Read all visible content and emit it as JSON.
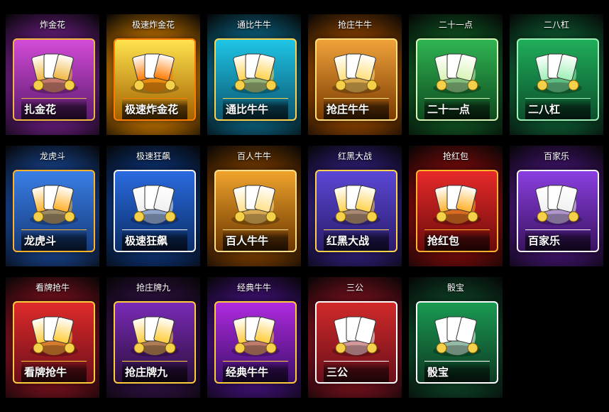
{
  "games": [
    {
      "title": "炸金花",
      "label": "扎金花",
      "icon": "cards-and-chips-icon",
      "colors": [
        "#5b1a6e",
        "#d34bd8",
        "#f0b640"
      ]
    },
    {
      "title": "极速炸金花",
      "label": "极速炸金花",
      "icon": "bomb-and-cards-icon",
      "colors": [
        "#a36100",
        "#ffe34d",
        "#ff7a00"
      ]
    },
    {
      "title": "通比牛牛",
      "label": "通比牛牛",
      "icon": "cow-with-gold-icon",
      "colors": [
        "#0a5670",
        "#1fc6e6",
        "#ffd24d"
      ]
    },
    {
      "title": "抢庄牛牛",
      "label": "抢庄牛牛",
      "icon": "ox-with-coins-icon",
      "colors": [
        "#7a3a00",
        "#f0a23a",
        "#ffe07a"
      ]
    },
    {
      "title": "二十一点",
      "label": "二十一点",
      "icon": "blackjack-cards-icon",
      "colors": [
        "#0e4a1e",
        "#2fb452",
        "#d8f4b6"
      ]
    },
    {
      "title": "二八杠",
      "label": "二八杠",
      "icon": "mahjong-tiles-icon",
      "colors": [
        "#0c4f2c",
        "#1fae5a",
        "#9ef0b6"
      ]
    },
    {
      "title": "龙虎斗",
      "label": "龙虎斗",
      "icon": "dragon-tiger-icon",
      "colors": [
        "#153a7a",
        "#3a7fe6",
        "#ffb12a"
      ]
    },
    {
      "title": "极速狂飙",
      "label": "极速狂飙",
      "icon": "race-car-icon",
      "colors": [
        "#0b2d66",
        "#2a6be0",
        "#f0f0f0"
      ]
    },
    {
      "title": "百人牛牛",
      "label": "百人牛牛",
      "icon": "pirate-cow-icon",
      "colors": [
        "#6a3500",
        "#f0a42c",
        "#ffe08a"
      ]
    },
    {
      "title": "红黑大战",
      "label": "红黑大战",
      "icon": "warriors-vs-icon",
      "colors": [
        "#2b1b6a",
        "#5a48d6",
        "#ffd24d"
      ]
    },
    {
      "title": "抢红包",
      "label": "抢红包",
      "icon": "red-envelope-girl-icon",
      "colors": [
        "#6a0a0a",
        "#e82a2a",
        "#ffb12a"
      ]
    },
    {
      "title": "百家乐",
      "label": "百家乐",
      "icon": "baccarat-chips-icon",
      "colors": [
        "#3a1260",
        "#8a3fe0",
        "#f1f1f1"
      ]
    },
    {
      "title": "看牌抢牛",
      "label": "看牌抢牛",
      "icon": "golden-bull-cards-icon",
      "colors": [
        "#6a0f1a",
        "#e02a2a",
        "#ffcc3a"
      ]
    },
    {
      "title": "抢庄牌九",
      "label": "抢庄牌九",
      "icon": "paigow-tiles-icon",
      "colors": [
        "#2a0f3a",
        "#7a2ab8",
        "#ffcc3a"
      ]
    },
    {
      "title": "经典牛牛",
      "label": "经典牛牛",
      "icon": "golden-bull-chips-icon",
      "colors": [
        "#3a0f6a",
        "#b02ae0",
        "#ffcc3a"
      ]
    },
    {
      "title": "三公",
      "label": "三公",
      "icon": "kings-cards-icon",
      "colors": [
        "#6a0f1a",
        "#d02a2a",
        "#ffffff"
      ]
    },
    {
      "title": "骰宝",
      "label": "骰宝",
      "icon": "dice-cup-icon",
      "colors": [
        "#0c3a22",
        "#1a9a52",
        "#ffffff"
      ]
    }
  ]
}
